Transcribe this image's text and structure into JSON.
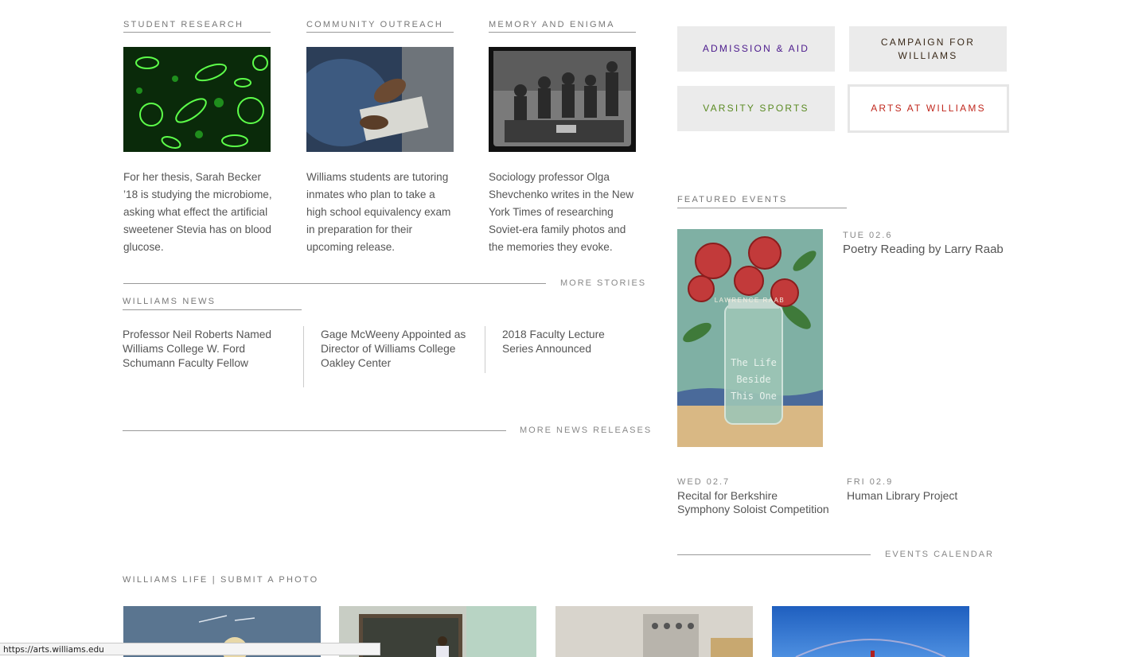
{
  "stories": [
    {
      "kicker": "STUDENT RESEARCH",
      "text": "For her thesis, Sarah Becker ’18 is studying the microbiome, asking what effect the artificial sweetener Stevia has on blood glucose."
    },
    {
      "kicker": "COMMUNITY OUTREACH",
      "text": "Williams students are tutoring inmates who plan to take a high school equivalency exam in preparation for their upcoming release."
    },
    {
      "kicker": "MEMORY AND ENIGMA",
      "text": "Sociology professor Olga Shevchenko writes in the New York Times of researching Soviet-era family photos and the memories they evoke."
    }
  ],
  "more_stories": "MORE STORIES",
  "news": {
    "kicker": "WILLIAMS NEWS",
    "items": [
      "Professor Neil Roberts Named Williams College W. Ford Schumann Faculty Fellow",
      "Gage McWeeny Appointed as Director of Williams College Oakley Center",
      "2018 Faculty Lecture Series Announced"
    ],
    "more": "MORE NEWS RELEASES"
  },
  "tiles": [
    {
      "label": "ADMISSION & AID",
      "color": "#4b1a8c"
    },
    {
      "label": "CAMPAIGN FOR WILLIAMS",
      "color": "#3a2a1a"
    },
    {
      "label": "VARSITY SPORTS",
      "color": "#5a8a22"
    },
    {
      "label": "ARTS AT WILLIAMS",
      "color": "#c0281e"
    }
  ],
  "events": {
    "kicker": "FEATURED EVENTS",
    "featured": {
      "date": "TUE 02.6",
      "title": "Poetry Reading by Larry Raab",
      "cover_author": "LAWRENCE RAAB",
      "cover_title": [
        "The Life",
        "Beside",
        "This One"
      ]
    },
    "items": [
      {
        "date": "WED 02.7",
        "title": "Recital for Berkshire Symphony Soloist Competition"
      },
      {
        "date": "FRI 02.9",
        "title": "Human Library Project"
      }
    ],
    "calendar": "EVENTS CALENDAR"
  },
  "life": {
    "label": "WILLIAMS LIFE | SUBMIT A PHOTO"
  },
  "status_url": "https://arts.williams.edu"
}
